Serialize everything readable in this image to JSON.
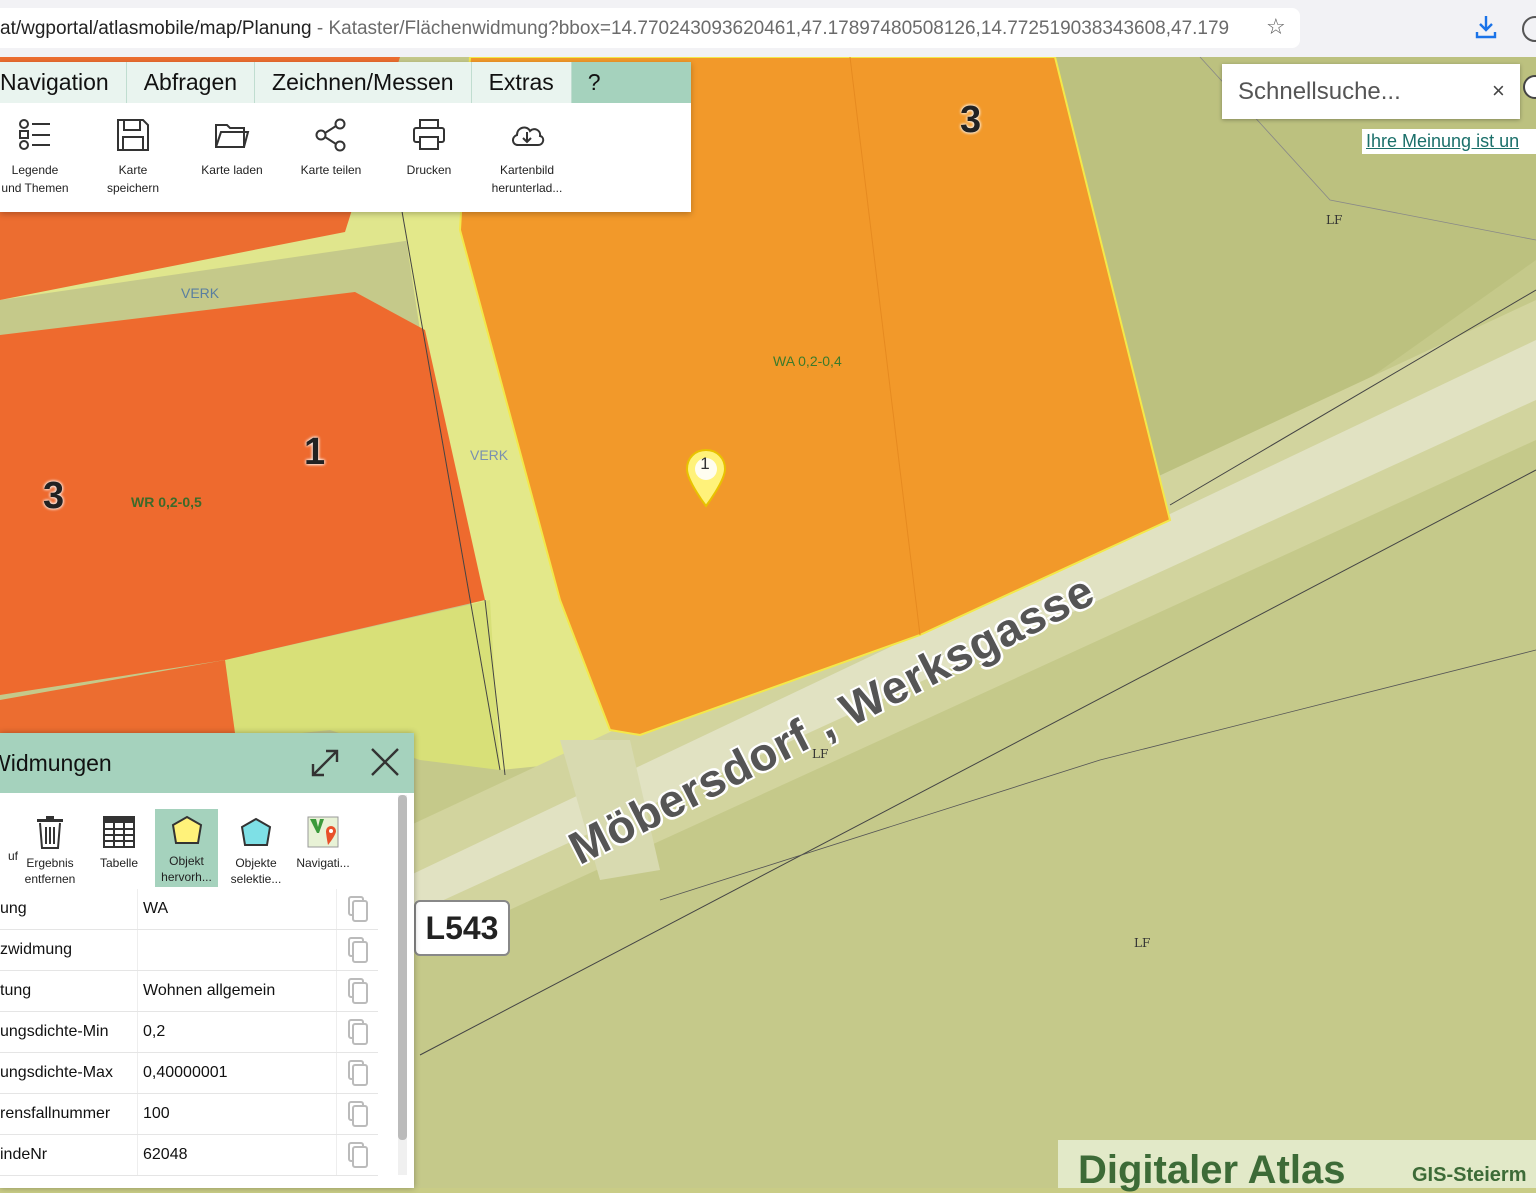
{
  "browser": {
    "url_prefix": "at/wgportal/atlasmobile/map/Planung",
    "url_rest": " - Kataster/Flächenwidmung?bbox=14.770243093620461,47.17897480508126,14.772519038343608,47.179"
  },
  "menu": {
    "tabs": [
      "Navigation",
      "Abfragen",
      "Zeichnen/Messen",
      "Extras",
      "?"
    ],
    "tools": [
      {
        "line1": "Legende",
        "line2": "und Themen"
      },
      {
        "line1": "Karte",
        "line2": "speichern"
      },
      {
        "line1": "Karte laden",
        "line2": ""
      },
      {
        "line1": "Karte teilen",
        "line2": ""
      },
      {
        "line1": "Drucken",
        "line2": ""
      },
      {
        "line1": "Kartenbild",
        "line2": "herunterlad..."
      }
    ]
  },
  "search": {
    "placeholder": "Schnellsuche...",
    "clear": "×",
    "feedback_link": "Ihre Meinung ist un"
  },
  "map": {
    "labels": {
      "verk1": "VERK",
      "verk2": "VERK",
      "wa": "WA 0,2-0,4",
      "wr": "WR 0,2-0,5",
      "lf1": "LF",
      "lf2": "LF",
      "lf3": "LF"
    },
    "parcel_numbers": {
      "a": "3",
      "b": "1",
      "c": "3"
    },
    "street": "Möbersdorf , Werksgasse",
    "road_badge": "L543",
    "marker": "1",
    "colors": {
      "orange_zone": "#f2992a",
      "red_zone": "#ee6a2e",
      "traffic": "#e3e88a",
      "field": "#c5c98a"
    }
  },
  "panel": {
    "title": "Widmungen",
    "tools": [
      {
        "line1": "uf",
        "line2": ""
      },
      {
        "line1": "Ergebnis",
        "line2": "entfernen"
      },
      {
        "line1": "Tabelle",
        "line2": ""
      },
      {
        "line1": "Objekt",
        "line2": "hervorh..."
      },
      {
        "line1": "Objekte",
        "line2": "selektie..."
      },
      {
        "line1": "Navigati...",
        "line2": ""
      }
    ],
    "rows": [
      {
        "key": "ung",
        "value": "WA"
      },
      {
        "key": "zwidmung",
        "value": ""
      },
      {
        "key": "tung",
        "value": "Wohnen allgemein"
      },
      {
        "key": "ungsdichte-Min",
        "value": "0,2"
      },
      {
        "key": "ungsdichte-Max",
        "value": "0,40000001"
      },
      {
        "key": "rensfallnummer",
        "value": "100"
      },
      {
        "key": "indeNr",
        "value": "62048"
      }
    ]
  },
  "footer": {
    "brand": "Digitaler Atlas",
    "sub": "GIS-Steierm"
  }
}
